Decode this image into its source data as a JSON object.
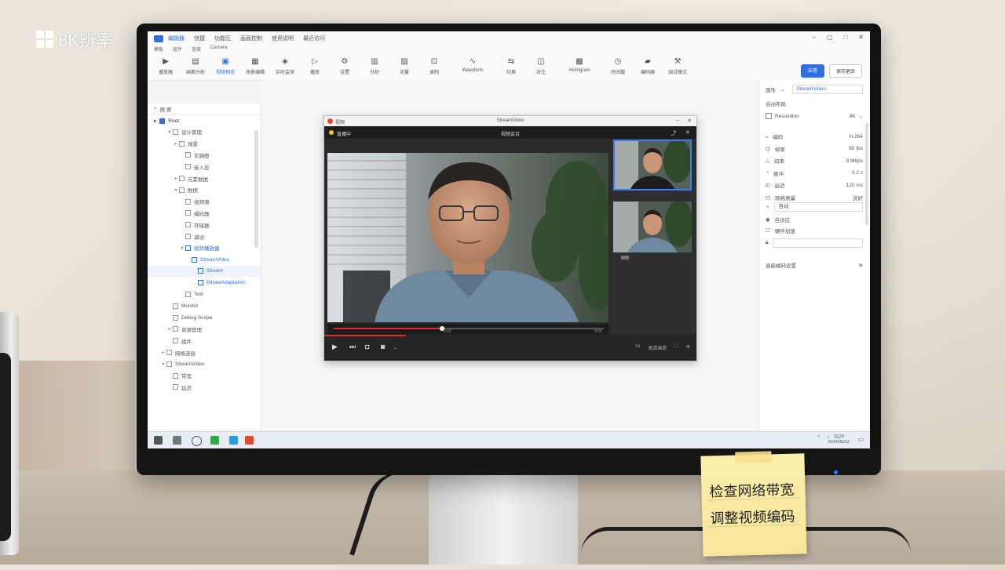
{
  "watermark": {
    "text": "8K辨率"
  },
  "app": {
    "menu": [
      "编辑器",
      "快捷",
      "功能区",
      "画面控制",
      "使用说明",
      "最近访问"
    ],
    "subtitle": [
      "模板",
      "组件",
      "连接",
      "Camera"
    ],
    "ribbon": [
      "播放器",
      "画面分析",
      "视频预览",
      "场景编辑",
      "实时监测",
      "播放",
      "设置",
      "分析",
      "流量",
      "录制",
      "Waveform",
      "切换",
      "对比",
      "Histogram",
      "时间戳",
      "编码器",
      "调试模式"
    ],
    "buttons": {
      "primary": "应用",
      "secondary": "保存更改"
    }
  },
  "left_panel": {
    "search": "搜 索",
    "root": "Root",
    "tree": [
      {
        "label": "设计管理",
        "indent": 2,
        "twisty": "▾"
      },
      {
        "label": "场景",
        "indent": 3,
        "twisty": "▸"
      },
      {
        "label": "实施图",
        "indent": 4,
        "twisty": ""
      },
      {
        "label": "嵌入层",
        "indent": 4,
        "twisty": ""
      },
      {
        "label": "元素数据",
        "indent": 3,
        "twisty": "▸"
      },
      {
        "label": "数据",
        "indent": 3,
        "twisty": "▾"
      },
      {
        "label": "视频源",
        "indent": 4,
        "twisty": ""
      },
      {
        "label": "编码器",
        "indent": 4,
        "twisty": ""
      },
      {
        "label": "存储器",
        "indent": 4,
        "twisty": ""
      },
      {
        "label": "调试",
        "indent": 4,
        "twisty": ""
      },
      {
        "label": "视频播放器",
        "indent": 4,
        "twisty": "▾",
        "selected": true
      },
      {
        "label": "StreamVideo",
        "indent": 5,
        "twisty": "",
        "selected": true
      },
      {
        "label": "Stream",
        "indent": 6,
        "twisty": "",
        "selected": true,
        "highlight": true
      },
      {
        "label": "BitrateAdaptation",
        "indent": 6,
        "twisty": "",
        "selected": true
      },
      {
        "label": "Text",
        "indent": 4,
        "twisty": ""
      },
      {
        "label": "Monitor",
        "indent": 2,
        "twisty": ""
      },
      {
        "label": "Debug Scope",
        "indent": 2,
        "twisty": ""
      },
      {
        "label": "资源管理",
        "indent": 2,
        "twisty": "▸"
      },
      {
        "label": "组件",
        "indent": 2,
        "twisty": ""
      },
      {
        "label": "网络连接",
        "indent": 1,
        "twisty": "▸"
      },
      {
        "label": "StreamVideo",
        "indent": 1,
        "twisty": "▾"
      },
      {
        "label": "带宽",
        "indent": 2,
        "twisty": ""
      },
      {
        "label": "延迟",
        "indent": 2,
        "twisty": ""
      }
    ]
  },
  "video_window": {
    "title_left": "视频",
    "title_center": "StreamVideo",
    "head_left": "直播中",
    "head_center": "视频会议",
    "time_current": "0:32",
    "time_total": "0:55",
    "progress": 0.4,
    "control_right": [
      "1x",
      "高清画质"
    ]
  },
  "right_panel": {
    "header_label": "属性",
    "header_select": "StreamVideo",
    "section": "自动布局",
    "checkbox_label": "Resolution",
    "checkbox_value": "4K",
    "props": [
      {
        "label": "编码",
        "value": "H.264"
      },
      {
        "label": "帧率",
        "value": "60 fps"
      },
      {
        "label": "码率",
        "value": "8 Mbps"
      },
      {
        "label": "缓冲",
        "value": "3.2 s"
      },
      {
        "label": "延迟",
        "value": "120 ms"
      },
      {
        "label": "网络质量",
        "value": "良好"
      }
    ],
    "select1": "自动",
    "toggle1": "自适应",
    "toggle2": "硬件加速",
    "footer": "高级编码设置"
  },
  "taskbar": {
    "clock_time": "10:24",
    "clock_date": "2024/05/12"
  },
  "sticky_note": {
    "line1": "检查网络带宽",
    "line2": "调整视频编码"
  },
  "colors": {
    "accent": "#2f6fe0",
    "progress": "#e02b2b",
    "sticky": "#f7e69a"
  }
}
